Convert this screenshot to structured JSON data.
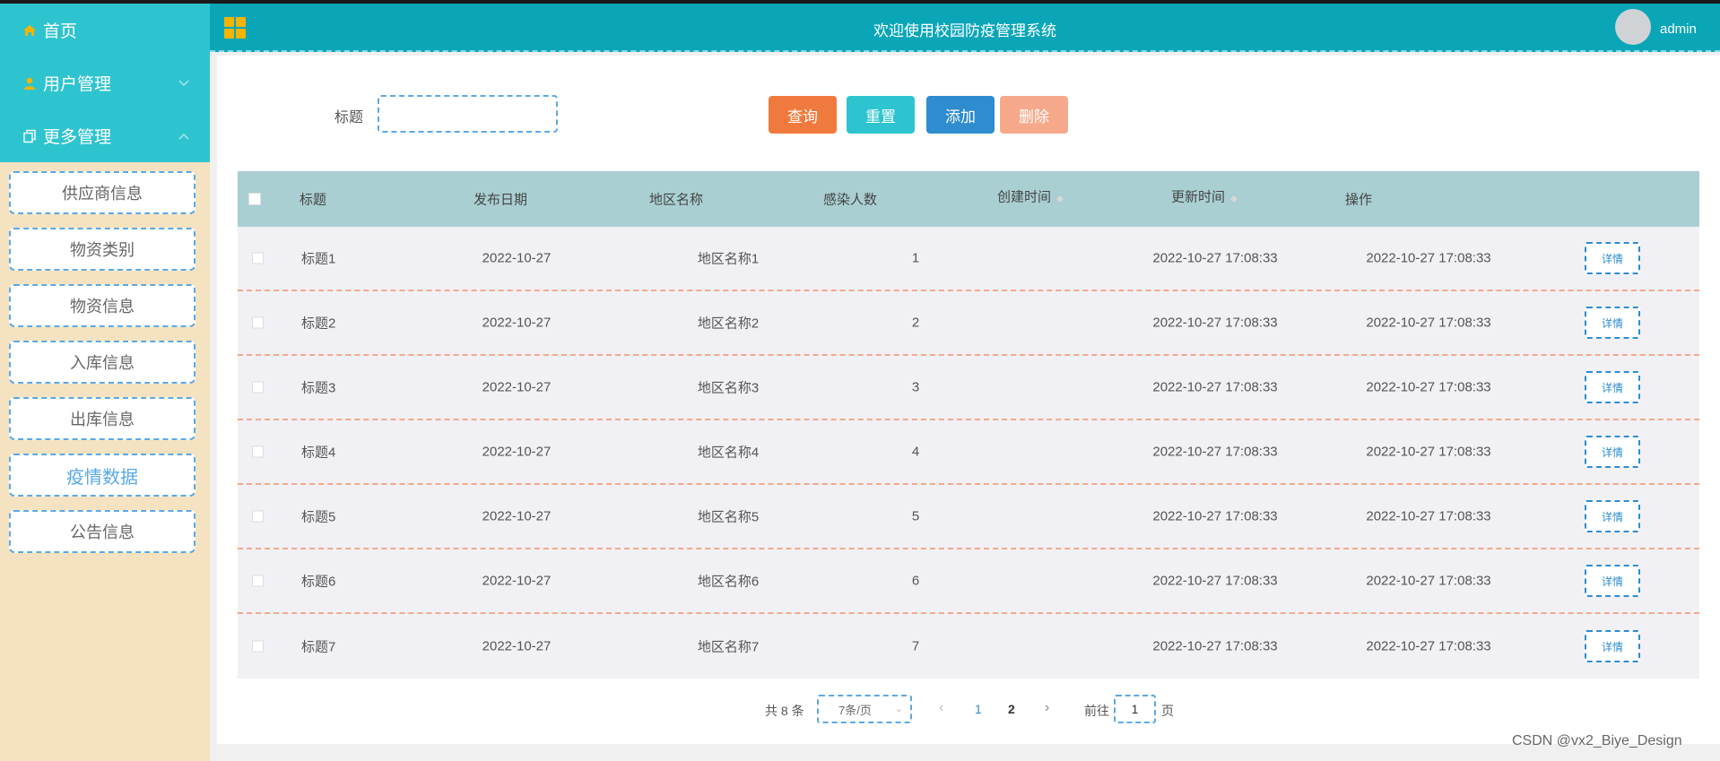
{
  "sidebar": {
    "home_label": "首页",
    "user_mgmt_label": "用户管理",
    "more_mgmt_label": "更多管理",
    "submenu": [
      {
        "label": "供应商信息"
      },
      {
        "label": "物资类别"
      },
      {
        "label": "物资信息"
      },
      {
        "label": "入库信息"
      },
      {
        "label": "出库信息"
      },
      {
        "label": "疫情数据"
      },
      {
        "label": "公告信息"
      }
    ],
    "active_item": "疫情数据"
  },
  "header": {
    "title": "欢迎使用校园防疫管理系统",
    "username": "admin"
  },
  "search": {
    "label": "标题",
    "value": ""
  },
  "actions": {
    "query": "查询",
    "reset": "重置",
    "add": "添加",
    "delete": "删除"
  },
  "table": {
    "columns": [
      "标题",
      "发布日期",
      "地区名称",
      "感染人数",
      "创建时间",
      "更新时间",
      "操作"
    ],
    "rows": [
      {
        "title": "标题1",
        "date": "2022-10-27",
        "region": "地区名称1",
        "count": "1",
        "created": "2022-10-27 17:08:33",
        "updated": "2022-10-27 17:08:33",
        "action": "详情"
      },
      {
        "title": "标题2",
        "date": "2022-10-27",
        "region": "地区名称2",
        "count": "2",
        "created": "2022-10-27 17:08:33",
        "updated": "2022-10-27 17:08:33",
        "action": "详情"
      },
      {
        "title": "标题3",
        "date": "2022-10-27",
        "region": "地区名称3",
        "count": "3",
        "created": "2022-10-27 17:08:33",
        "updated": "2022-10-27 17:08:33",
        "action": "详情"
      },
      {
        "title": "标题4",
        "date": "2022-10-27",
        "region": "地区名称4",
        "count": "4",
        "created": "2022-10-27 17:08:33",
        "updated": "2022-10-27 17:08:33",
        "action": "详情"
      },
      {
        "title": "标题5",
        "date": "2022-10-27",
        "region": "地区名称5",
        "count": "5",
        "created": "2022-10-27 17:08:33",
        "updated": "2022-10-27 17:08:33",
        "action": "详情"
      },
      {
        "title": "标题6",
        "date": "2022-10-27",
        "region": "地区名称6",
        "count": "6",
        "created": "2022-10-27 17:08:33",
        "updated": "2022-10-27 17:08:33",
        "action": "详情"
      },
      {
        "title": "标题7",
        "date": "2022-10-27",
        "region": "地区名称7",
        "count": "7",
        "created": "2022-10-27 17:08:33",
        "updated": "2022-10-27 17:08:33",
        "action": "详情"
      }
    ]
  },
  "pagination": {
    "total": "共 8 条",
    "page_size": "7条/页",
    "pages": [
      "1",
      "2"
    ],
    "current_page": "2",
    "goto_label": "前往",
    "goto_value": "1",
    "page_suffix": "页"
  },
  "watermark": "CSDN @vx2_Biye_Design",
  "colors": {
    "header": "#0aa6b8",
    "sidebar_menu": "#2ec4cf",
    "sidebar_bg": "#f5e2c0",
    "query": "#f07a3e",
    "reset": "#2ec4cf",
    "add": "#2e8ccf",
    "delete": "#f6a98a",
    "table_header": "#a9cfd2"
  }
}
